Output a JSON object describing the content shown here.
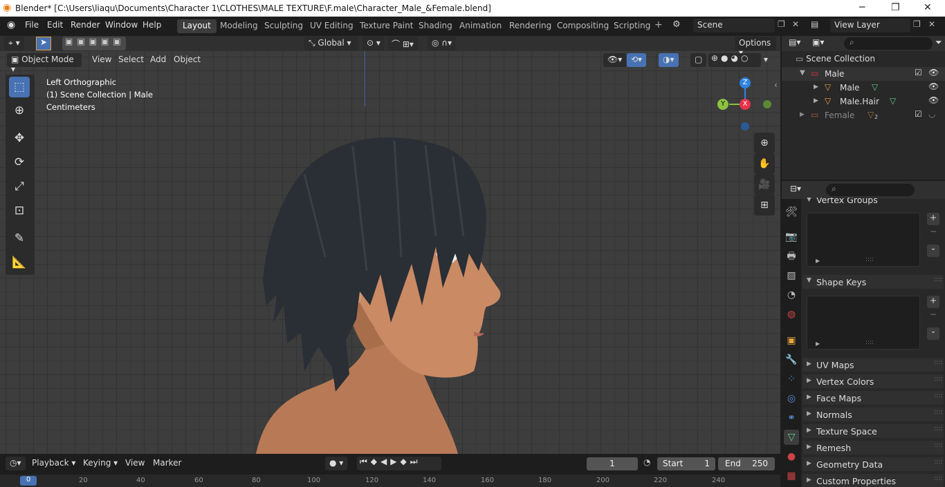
{
  "window": {
    "title": "Blender* [C:\\Users\\liaqu\\Documents\\Character 1\\CLOTHES\\MALE TEXTURE\\F.male\\Character_Male_&Female.blend]"
  },
  "menus": [
    "File",
    "Edit",
    "Render",
    "Window",
    "Help"
  ],
  "workspaces": [
    "Layout",
    "Modeling",
    "Sculpting",
    "UV Editing",
    "Texture Paint",
    "Shading",
    "Animation",
    "Rendering",
    "Compositing",
    "Scripting"
  ],
  "active_workspace": "Layout",
  "scene": {
    "name": "Scene",
    "view_layer": "View Layer"
  },
  "viewport": {
    "mode": "Object Mode",
    "menus": [
      "View",
      "Select",
      "Add",
      "Object"
    ],
    "transform_orientation": "Global",
    "options_label": "Options",
    "overlay_lines": [
      "Left Orthographic",
      "(1) Scene Collection | Male",
      "Centimeters"
    ],
    "gizmo_axes": {
      "z": "Z",
      "y": "Y",
      "x": "X"
    }
  },
  "outliner": {
    "root": "Scene Collection",
    "items": [
      {
        "label": "Male",
        "type": "collection"
      },
      {
        "label": "Male",
        "type": "mesh"
      },
      {
        "label": "Male.Hair",
        "type": "mesh"
      },
      {
        "label": "Female",
        "type": "collection",
        "badge": "2"
      }
    ]
  },
  "properties": {
    "panels": [
      "Vertex Groups",
      "Shape Keys",
      "UV Maps",
      "Vertex Colors",
      "Face Maps",
      "Normals",
      "Texture Space",
      "Remesh",
      "Geometry Data",
      "Custom Properties"
    ]
  },
  "timeline": {
    "menus": [
      "Playback",
      "Keying",
      "View",
      "Marker"
    ],
    "current_frame": "1",
    "start_label": "Start",
    "start": "1",
    "end_label": "End",
    "end": "250",
    "ruler": [
      "0",
      "20",
      "40",
      "60",
      "80",
      "100",
      "120",
      "140",
      "160",
      "180",
      "200",
      "220",
      "240"
    ]
  },
  "colors": {
    "accent": "#4772b3",
    "axis_x": "#e6324a",
    "axis_y": "#8bc23f",
    "axis_z": "#2f83e3",
    "hair": "#2a2e35",
    "skin": "#c98a64"
  }
}
